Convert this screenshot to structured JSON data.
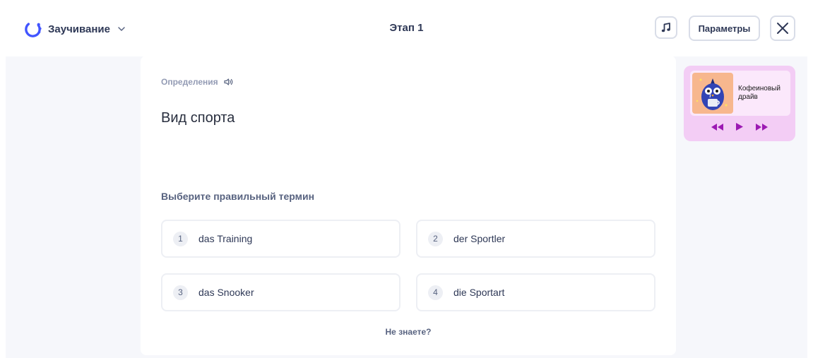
{
  "header": {
    "mode_label": "Заучивание",
    "stage_title": "Этап 1",
    "settings_label": "Параметры"
  },
  "question": {
    "section_label": "Определения",
    "definition": "Вид спорта",
    "prompt": "Выберите правильный термин",
    "options": [
      {
        "number": "1",
        "text": "das Training"
      },
      {
        "number": "2",
        "text": "der Sportler"
      },
      {
        "number": "3",
        "text": "das Snooker"
      },
      {
        "number": "4",
        "text": "die Sportart"
      }
    ],
    "dont_know_label": "Не знаете?"
  },
  "music_player": {
    "track_name": "Кофеиновый драйв"
  },
  "colors": {
    "brand": "#4255ff",
    "player_bg": "#f3cdf5",
    "player_controls": "#9c19b3"
  }
}
